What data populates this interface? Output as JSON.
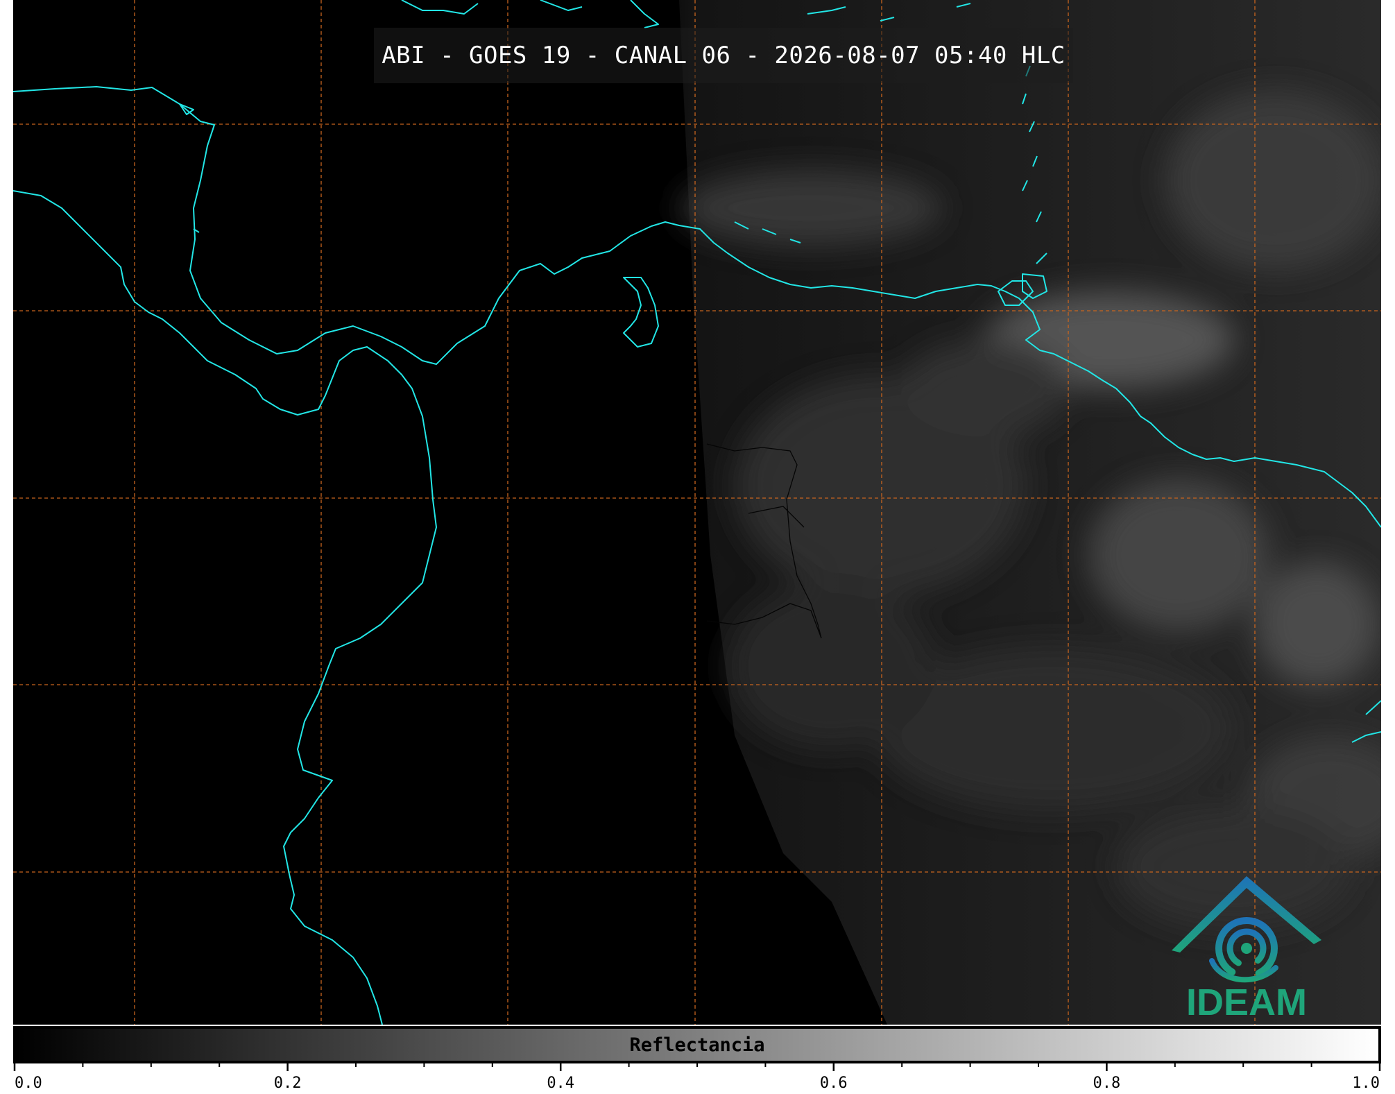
{
  "title": "ABI - GOES 19 - CANAL 06 - 2026-08-07 05:40 HLC",
  "colorbar": {
    "label": "Reflectancia",
    "ticks": [
      "0.0",
      "0.2",
      "0.4",
      "0.6",
      "0.8",
      "1.0"
    ],
    "range": [
      0.0,
      1.0
    ],
    "colormap": [
      "#000000",
      "#ffffff"
    ]
  },
  "logo": {
    "text": "IDEAM",
    "color_blue": "#1e73b8",
    "color_green": "#1fa57a"
  },
  "colors": {
    "coastline": "#22e6e6",
    "gridline": "#c8641e",
    "background": "#000000"
  }
}
